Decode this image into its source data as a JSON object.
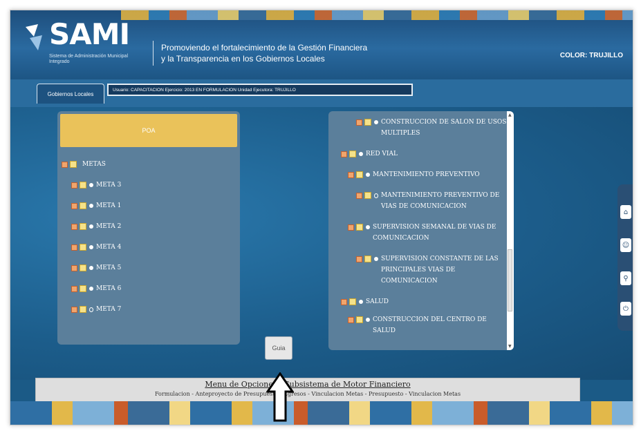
{
  "header": {
    "logo_text": "SAMI",
    "logo_sub": "Sistema de Administración Municipal Integrado",
    "tagline_line1": "Promoviendo el fortalecimiento de la Gestión Financiera",
    "tagline_line2": "y la Transparencia en los Gobiernos Locales",
    "entity": "COLOR: TRUJILLO"
  },
  "tabbar": {
    "tab_label": "Gobiernos Locales",
    "info": "Usuario: CAPACITACION   Ejercicio: 2013 EN FORMULACION   Unidad Ejecutora: TRUJILLO"
  },
  "left_panel": {
    "header": "POA",
    "root": "METAS",
    "items": [
      "META 3",
      "META 1",
      "META 2",
      "META 4",
      "META 5",
      "META 6",
      "META 7"
    ]
  },
  "right_panel": {
    "items": [
      {
        "label": "CONSTRUCCION DE SALON DE USOS MULTIPLES",
        "level": 2
      },
      {
        "label": "RED VIAL",
        "level": 0
      },
      {
        "label": "MANTENIMIENTO PREVENTIVO",
        "level": 1
      },
      {
        "label": "MANTENIMIENTO PREVENTIVO DE VIAS DE COMUNICACION",
        "level": 2
      },
      {
        "label": "SUPERVISION SEMANAL DE VIAS DE COMUNICACION",
        "level": 1
      },
      {
        "label": "SUPERVISION CONSTANTE DE LAS PRINCIPALES VIAS DE COMUNICACION",
        "level": 2
      },
      {
        "label": "SALUD",
        "level": 0
      },
      {
        "label": "CONSTRUCCION DEL CENTRO DE SALUD",
        "level": 1
      }
    ]
  },
  "guia_button": "Guia",
  "footer_menu": {
    "title": "Menu de Opciones - Subsistema de Motor Financiero",
    "links": "Formulacion - Anteproyecto de Presupuesto - Egresos - Vinculacion Metas - Presupuesto - Vinculacion Metas"
  },
  "colors": {
    "poa_bar": "#eac25a",
    "panel": "#5b7f9b",
    "background": "#1c5d8b"
  }
}
